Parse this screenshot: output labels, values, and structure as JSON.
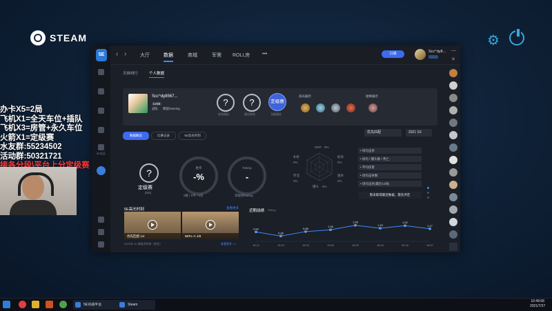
{
  "steam": {
    "title": "STEAM"
  },
  "overlay": {
    "lines": [
      "办卡X5=2局",
      "飞机X1=全天车位+插队",
      "飞机X3=房管+永久车位",
      "火箭X1=定级赛",
      "水友群:55234502",
      "活动群:50321721"
    ],
    "red_line": "接各分段\\平台上分定级赛"
  },
  "app": {
    "logo": "5E",
    "nav_tabs": [
      "大厅",
      "数据",
      "商城",
      "军需",
      "ROLL房",
      "•••"
    ],
    "active_tab": "数据",
    "top_button": "口袋",
    "user_name": "Scc^dy8...",
    "sub_tabs": [
      "天梯排行",
      "个人数据"
    ],
    "rail_label": "5E社区",
    "profile": {
      "name": "Scc^dy8567...",
      "level": "LV35",
      "team_label": "战队",
      "team_name": "德鼠Gaming",
      "q1_label": "优先段位",
      "q2_label": "段位排名",
      "rank_badge": "定级赛",
      "rank_label": "当前段位",
      "honor_title": "高光展示",
      "medal_title": "勋章展示"
    },
    "controls": {
      "buttons": [
        "数据概览",
        "比赛记录",
        "5E高光时刻"
      ],
      "mode": "优先匹配",
      "season": "2021 S3"
    },
    "stats": {
      "rank_text": "定级赛",
      "rank_sub": "(0/5)",
      "kd_label": "胜率",
      "kd_value": "-%",
      "kd_sub": "0胜 / 0平 / 0负",
      "rating_label": "Rating",
      "rating_value": "-",
      "rating_sub": "常规场Rating"
    },
    "radar": {
      "labels": [
        "MVP",
        "助攻",
        "狙杀",
        "爆头",
        "存活",
        "补枪"
      ],
      "values": [
        "0%",
        "0%",
        "0%",
        "0%",
        "0%",
        "0%",
        "0%"
      ]
    },
    "legend": [
      "• 场均击杀",
      "• 场均 / 爆头数 • 死亡",
      "• 平均伤害",
      "• 场均击杀数",
      "• 场均击杀(最近10场)"
    ],
    "legend_note": "暂未取得最近数据，需先评定",
    "highlights": {
      "title": "5E高光时刻",
      "more": "查看更多",
      "clips": [
        {
          "caption": "优先匹配    1/4"
        },
        {
          "caption": "5EPL-C    4/8"
        }
      ],
      "foot_left": "2021年 11 场高光时刻（优先）",
      "foot_right": "查看更多 >>"
    }
  },
  "chart_data": {
    "type": "line",
    "title": "近期战绩",
    "subtitle": "Rating",
    "x": [
      "16:12",
      "16:10",
      "16:03",
      "15:56",
      "16:03",
      "16:16",
      "04:16",
      "16:07"
    ],
    "values": [
      0.82,
      0.36,
      0.86,
      1.06,
      1.56,
      1.23,
      1.52,
      1.17
    ],
    "value_labels": [
      "0.82",
      "0.36",
      "0.86",
      "1.06",
      "1.56",
      "1.23",
      "1.52",
      "1.17"
    ],
    "ylim": [
      0,
      2
    ]
  },
  "taskbar": {
    "tasks": [
      "5E对战平台",
      "Steam"
    ],
    "time": "10:49:58",
    "date": "2021/7/27"
  }
}
